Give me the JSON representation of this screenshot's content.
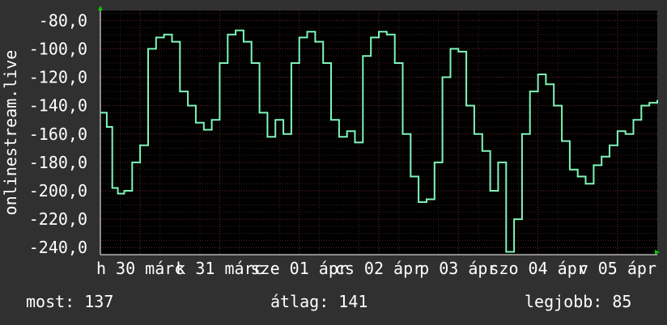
{
  "chart_data": {
    "type": "line",
    "ylabel": "onlinestream.live",
    "ylim": [
      -245,
      -73
    ],
    "yticks": [
      -80,
      -100,
      -120,
      -140,
      -160,
      -180,
      -200,
      -220,
      -240
    ],
    "ytick_labels": [
      "-80,0",
      "-100,0",
      "-120,0",
      "-140,0",
      "-160,0",
      "-180,0",
      "-200,0",
      "-220,0",
      "-240,0"
    ],
    "xlim": [
      0,
      7
    ],
    "xticks": [
      0.5,
      1.5,
      2.5,
      3.5,
      4.5,
      5.5,
      6.5
    ],
    "xtick_labels": [
      "h 30 márc",
      "k 31 márc",
      "sze 01 ápr",
      "cs 02 ápr",
      "p 03 ápr",
      "szo 04 ápr",
      "v 05 ápr"
    ],
    "grid": true,
    "series": [
      {
        "color": "#7ff5b9",
        "x": [
          0.0,
          0.08,
          0.15,
          0.22,
          0.3,
          0.4,
          0.5,
          0.6,
          0.7,
          0.8,
          0.9,
          1.0,
          1.1,
          1.2,
          1.3,
          1.4,
          1.5,
          1.6,
          1.7,
          1.8,
          1.9,
          2.0,
          2.1,
          2.2,
          2.3,
          2.4,
          2.5,
          2.6,
          2.7,
          2.8,
          2.9,
          3.0,
          3.1,
          3.2,
          3.3,
          3.4,
          3.5,
          3.6,
          3.7,
          3.8,
          3.9,
          4.0,
          4.1,
          4.2,
          4.3,
          4.4,
          4.5,
          4.6,
          4.7,
          4.8,
          4.9,
          5.0,
          5.1,
          5.2,
          5.3,
          5.4,
          5.5,
          5.6,
          5.7,
          5.8,
          5.9,
          6.0,
          6.1,
          6.2,
          6.3,
          6.4,
          6.5,
          6.6,
          6.7,
          6.8,
          6.9,
          7.0
        ],
        "values": [
          -145,
          -155,
          -198,
          -202,
          -200,
          -180,
          -168,
          -100,
          -92,
          -90,
          -95,
          -130,
          -140,
          -152,
          -157,
          -150,
          -110,
          -90,
          -87,
          -95,
          -110,
          -145,
          -162,
          -150,
          -160,
          -110,
          -92,
          -88,
          -95,
          -110,
          -150,
          -162,
          -158,
          -166,
          -105,
          -92,
          -88,
          -90,
          -110,
          -160,
          -190,
          -208,
          -206,
          -180,
          -120,
          -100,
          -102,
          -140,
          -160,
          -172,
          -200,
          -180,
          -243,
          -220,
          -160,
          -130,
          -118,
          -125,
          -140,
          -165,
          -185,
          -190,
          -195,
          -182,
          -176,
          -168,
          -158,
          -160,
          -150,
          -140,
          -138,
          -136
        ]
      }
    ]
  },
  "stats": {
    "current": "most: 137",
    "average": "átlag: 141",
    "best": "legjobb: 85"
  }
}
